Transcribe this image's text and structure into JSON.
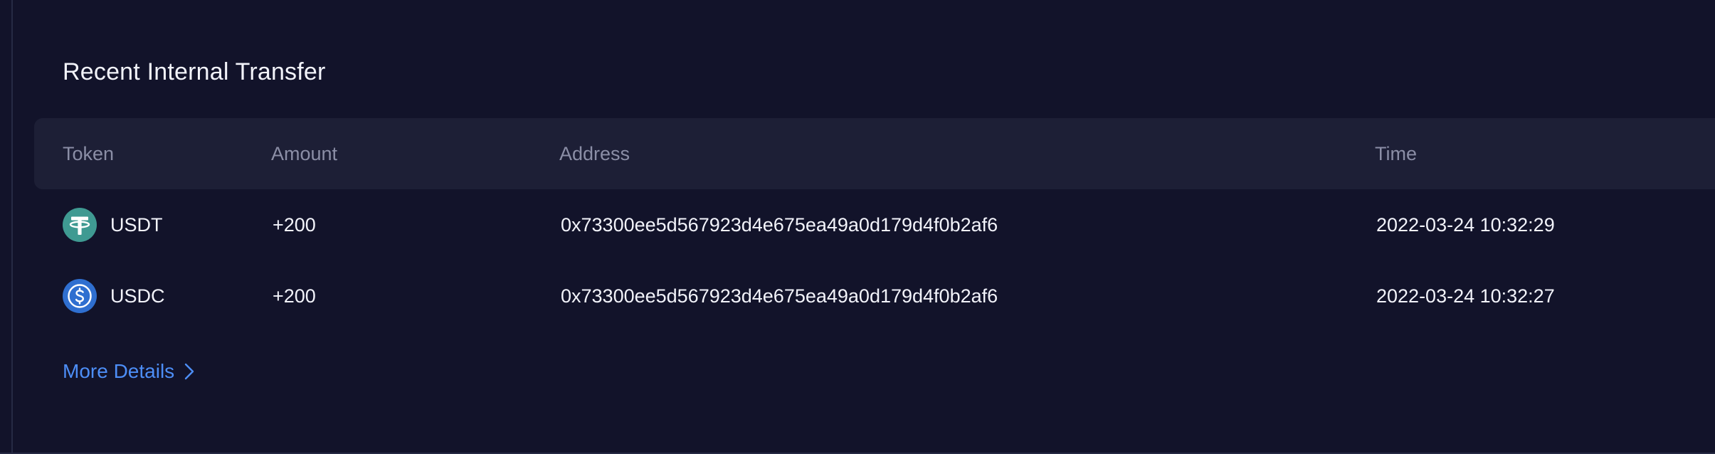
{
  "section": {
    "title": "Recent Internal Transfer"
  },
  "table": {
    "columns": {
      "token": "Token",
      "amount": "Amount",
      "address": "Address",
      "time": "Time"
    },
    "rows": [
      {
        "token": "USDT",
        "token_icon": "usdt-tether-icon",
        "amount": "+200",
        "address": "0x73300ee5d567923d4e675ea49a0d179d4f0b2af6",
        "time": "2022-03-24 10:32:29"
      },
      {
        "token": "USDC",
        "token_icon": "usdc-circle-icon",
        "amount": "+200",
        "address": "0x73300ee5d567923d4e675ea49a0d179d4f0b2af6",
        "time": "2022-03-24 10:32:27"
      }
    ]
  },
  "footer": {
    "more_label": "More Details",
    "more_icon": "chevron-right-icon"
  },
  "colors": {
    "background": "#12132a",
    "header_background": "#1d1f36",
    "link": "#4d8ef7",
    "usdt_brand": "#3f9a92",
    "usdc_brand": "#2f6fd0"
  }
}
